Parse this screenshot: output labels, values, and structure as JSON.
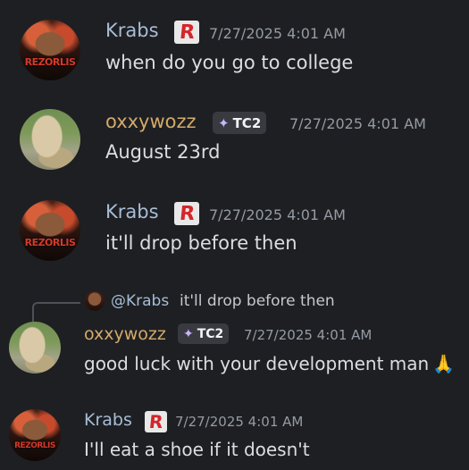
{
  "messages": [
    {
      "author": "Krabs",
      "badge": "R",
      "timestamp": "7/27/2025 4:01 AM",
      "text": "when do you go to college",
      "avatar_logo": "REZORLIS"
    },
    {
      "author": "oxxywozz",
      "tag": "TC2",
      "timestamp": "7/27/2025 4:01 AM",
      "text": "August 23rd"
    },
    {
      "author": "Krabs",
      "badge": "R",
      "timestamp": "7/27/2025 4:01 AM",
      "text": "it'll drop before then",
      "avatar_logo": "REZORLIS"
    },
    {
      "author": "oxxywozz",
      "tag": "TC2",
      "timestamp": "7/27/2025 4:01 AM",
      "text": "good luck with your development man",
      "emoji": "🙏",
      "reply": {
        "mention": "@Krabs",
        "text": "it'll drop before then"
      }
    },
    {
      "author": "Krabs",
      "badge": "R",
      "timestamp": "7/27/2025 4:01 AM",
      "text": "I'll eat a shoe if it doesn't",
      "avatar_logo": "REZORLIS"
    }
  ],
  "icons": {
    "tag_icon": "sparkle-icon",
    "badge_icon": "roblox-r-icon"
  },
  "colors": {
    "background": "#1e1f22",
    "krabs_name": "#a7bdd6",
    "oxxy_name": "#d3aa6a",
    "timestamp": "#949ba4",
    "text": "#dbdee1"
  }
}
